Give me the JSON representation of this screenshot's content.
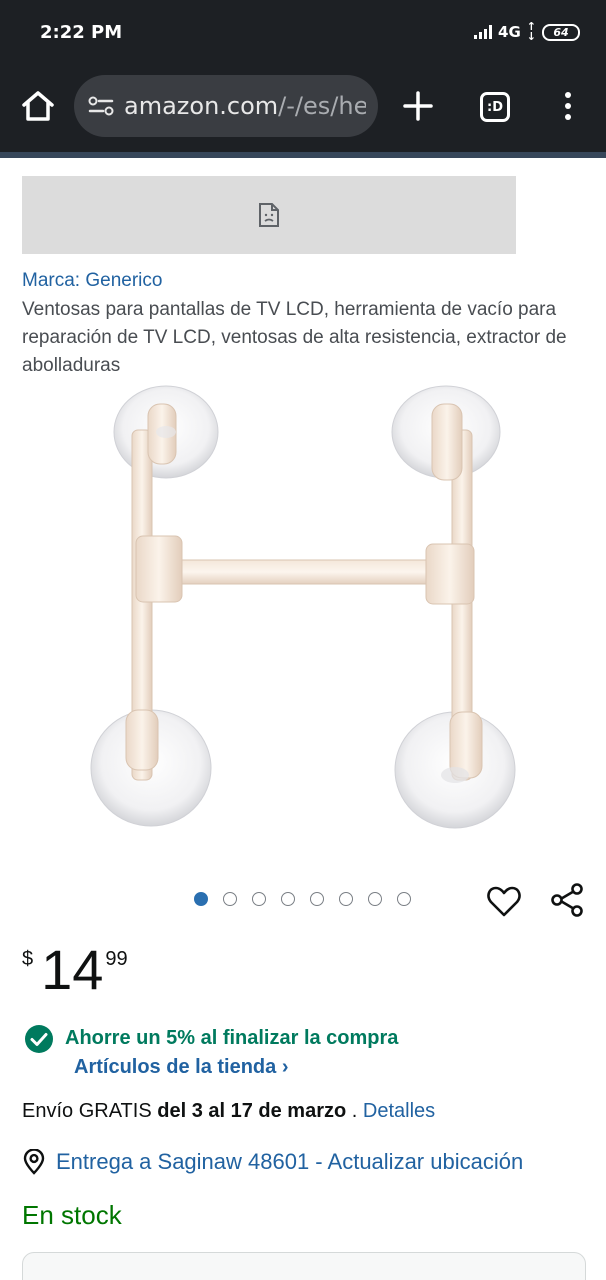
{
  "status_bar": {
    "time": "2:22 PM",
    "network": "4G",
    "battery": "64"
  },
  "browser": {
    "url_host": "amazon.com",
    "url_path": "/-/es/her",
    "tabs_label": ":D"
  },
  "product": {
    "brand": "Marca: Generico",
    "title": "Ventosas para pantallas de TV LCD, herramienta de vacío para reparación de TV LCD, ventosas de alta resistencia, extractor de abolladuras",
    "carousel": {
      "count": 8,
      "active_index": 0
    }
  },
  "price": {
    "currency": "$",
    "whole": "14",
    "fraction": "99"
  },
  "savings": {
    "text": "Ahorre un 5% al finalizar la compra",
    "link": "Artículos de la tienda ›"
  },
  "shipping": {
    "prefix": "Envío GRATIS",
    "dates": "del 3 al 17 de marzo",
    "separator": " . ",
    "details_link": "Detalles"
  },
  "delivery": {
    "text": "Entrega a Saginaw 48601 - Actualizar ubicación"
  },
  "stock": "En stock",
  "colors": {
    "link": "#2162a1",
    "savings_green": "#007a5e",
    "stock_green": "#007600",
    "active_dot": "#2a6fb0"
  }
}
